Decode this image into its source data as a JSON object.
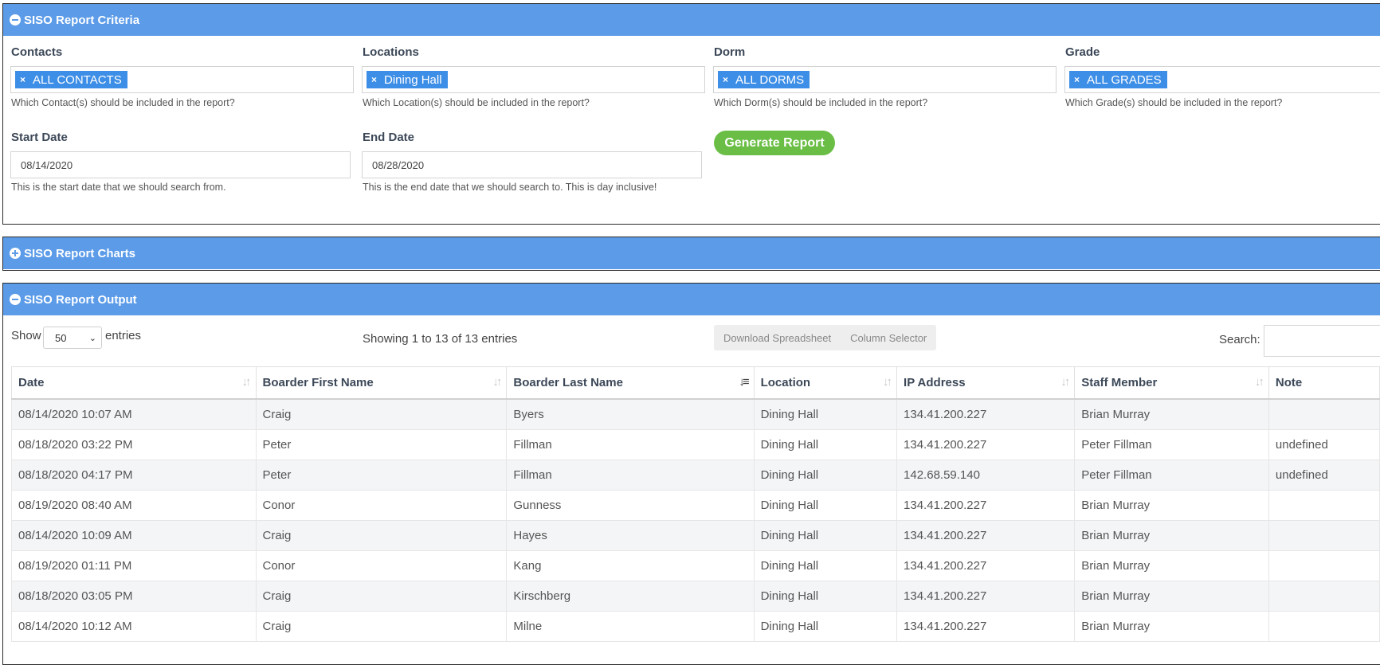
{
  "criteria": {
    "title": "SISO Report Criteria",
    "contacts": {
      "label": "Contacts",
      "tag": "ALL CONTACTS",
      "help": "Which Contact(s) should be included in the report?"
    },
    "locations": {
      "label": "Locations",
      "tag": "Dining Hall",
      "help": "Which Location(s) should be included in the report?"
    },
    "dorm": {
      "label": "Dorm",
      "tag": "ALL DORMS",
      "help": "Which Dorm(s) should be included in the report?"
    },
    "grade": {
      "label": "Grade",
      "tag": "ALL GRADES",
      "help": "Which Grade(s) should be included in the report?"
    },
    "start_date": {
      "label": "Start Date",
      "value": "08/14/2020",
      "help": "This is the start date that we should search from."
    },
    "end_date": {
      "label": "End Date",
      "value": "08/28/2020",
      "help": "This is the end date that we should search to. This is day inclusive!"
    },
    "generate_button": "Generate Report"
  },
  "charts": {
    "title": "SISO Report Charts"
  },
  "output": {
    "title": "SISO Report Output",
    "show_label": "Show",
    "entries_value": "50",
    "entries_label": "entries",
    "info": "Showing 1 to 13 of 13 entries",
    "download_button": "Download Spreadsheet",
    "column_selector_button": "Column Selector",
    "search_label": "Search:",
    "columns": [
      "Date",
      "Boarder First Name",
      "Boarder Last Name",
      "Location",
      "IP Address",
      "Staff Member",
      "Note"
    ],
    "rows": [
      [
        "08/14/2020 10:07 AM",
        "Craig",
        "Byers",
        "Dining Hall",
        "134.41.200.227",
        "Brian Murray",
        ""
      ],
      [
        "08/18/2020 03:22 PM",
        "Peter",
        "Fillman",
        "Dining Hall",
        "134.41.200.227",
        "Peter Fillman",
        "undefined"
      ],
      [
        "08/18/2020 04:17 PM",
        "Peter",
        "Fillman",
        "Dining Hall",
        "142.68.59.140",
        "Peter Fillman",
        "undefined"
      ],
      [
        "08/19/2020 08:40 AM",
        "Conor",
        "Gunness",
        "Dining Hall",
        "134.41.200.227",
        "Brian Murray",
        ""
      ],
      [
        "08/14/2020 10:09 AM",
        "Craig",
        "Hayes",
        "Dining Hall",
        "134.41.200.227",
        "Brian Murray",
        ""
      ],
      [
        "08/19/2020 01:11 PM",
        "Conor",
        "Kang",
        "Dining Hall",
        "134.41.200.227",
        "Brian Murray",
        ""
      ],
      [
        "08/18/2020 03:05 PM",
        "Craig",
        "Kirschberg",
        "Dining Hall",
        "134.41.200.227",
        "Brian Murray",
        ""
      ],
      [
        "08/14/2020 10:12 AM",
        "Craig",
        "Milne",
        "Dining Hall",
        "134.41.200.227",
        "Brian Murray",
        ""
      ]
    ]
  }
}
